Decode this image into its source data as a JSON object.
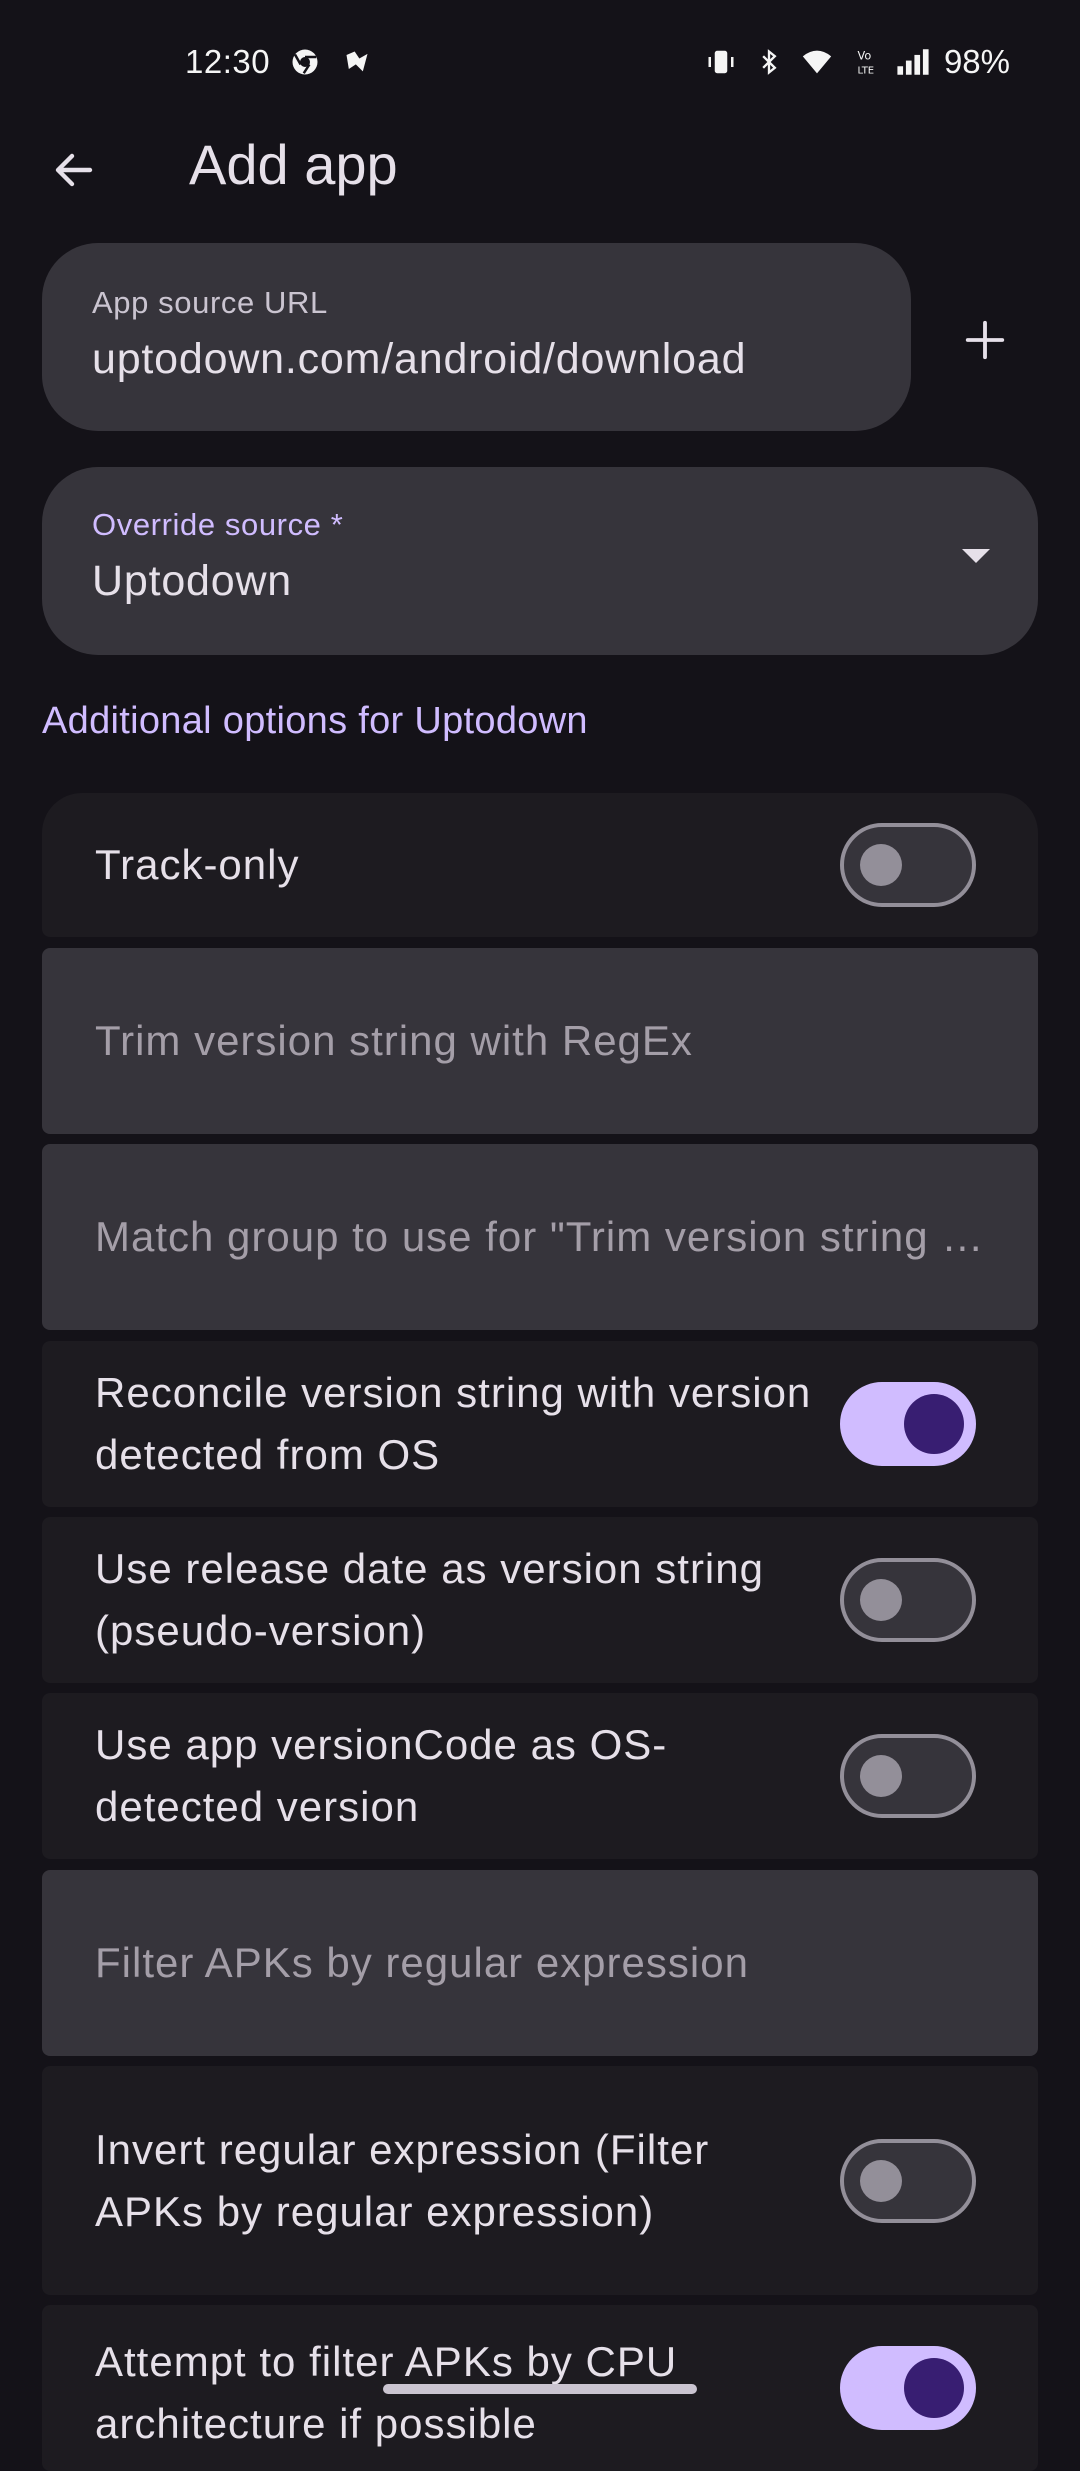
{
  "status_bar": {
    "time": "12:30",
    "battery": "98%"
  },
  "app_bar": {
    "title": "Add app"
  },
  "url_field": {
    "label": "App source URL",
    "value": "uptodown.com/android/download"
  },
  "source_field": {
    "label": "Override source *",
    "value": "Uptodown"
  },
  "section_heading": "Additional options for Uptodown",
  "options": {
    "track_only": {
      "label": "Track-only",
      "enabled": false
    },
    "trim_regex": {
      "placeholder": "Trim version string with RegEx"
    },
    "match_group": {
      "placeholder": "Match group to use for \"Trim version string with RegEx\""
    },
    "reconcile": {
      "label": "Reconcile version string with version detected from OS",
      "enabled": true
    },
    "release_date": {
      "label": "Use release date as version string (pseudo-version)",
      "enabled": false
    },
    "version_code": {
      "label": "Use app versionCode as OS-detected version",
      "enabled": false
    },
    "filter_apks": {
      "placeholder": "Filter APKs by regular expression"
    },
    "invert_regex": {
      "label": "Invert regular expression (Filter APKs by regular expression)",
      "enabled": false
    },
    "cpu_filter": {
      "label": "Attempt to filter APKs by CPU architecture if possible",
      "enabled": true
    }
  },
  "colors": {
    "background": "#141218",
    "surface": "#1d1b20",
    "input": "#36343b",
    "accent": "#d0bcff"
  }
}
